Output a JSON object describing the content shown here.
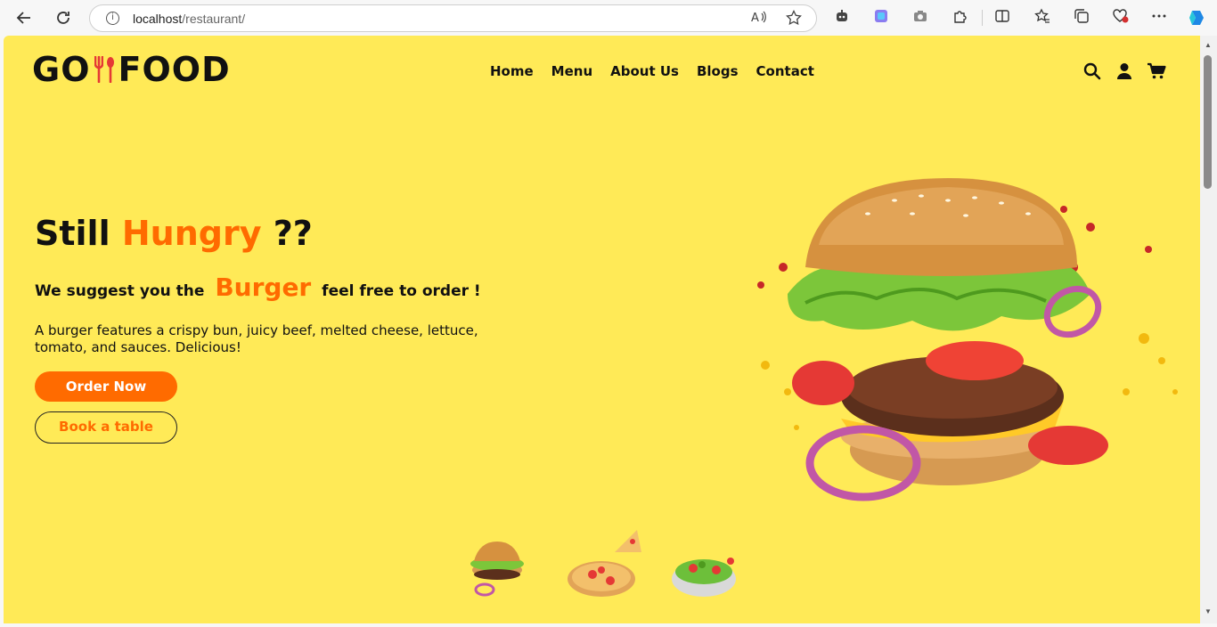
{
  "browser": {
    "url_host": "localhost",
    "url_path": "/restaurant/",
    "icons": [
      "back-icon",
      "reload-icon",
      "info-icon",
      "read-aloud-icon",
      "favorite-star-icon",
      "robot-icon",
      "app-icon",
      "camera-icon",
      "extensions-icon",
      "split-screen-icon",
      "favorites-icon",
      "collections-icon",
      "browser-essentials-icon",
      "more-icon",
      "copilot-icon"
    ]
  },
  "logo": {
    "left": "GO",
    "right": "FOOD"
  },
  "nav": {
    "items": [
      "Home",
      "Menu",
      "About Us",
      "Blogs",
      "Contact"
    ]
  },
  "header_icons": [
    "search-icon",
    "user-icon",
    "cart-icon"
  ],
  "hero": {
    "title_pre": "Still",
    "title_accent": "Hungry",
    "title_post": "??",
    "suggest_pre": "We suggest you the",
    "suggest_accent": "Burger",
    "suggest_post": "feel free to order !",
    "description": "A burger features a crispy bun, juicy beef, melted cheese, lettuce, tomato, and sauces. Delicious!",
    "order_button": "Order Now",
    "book_button": "Book a table"
  },
  "thumbnails": [
    "burger-thumb",
    "pizza-thumb",
    "salad-thumb"
  ],
  "colors": {
    "background": "#ffea57",
    "accent": "#ff6b00",
    "text": "#111111"
  }
}
